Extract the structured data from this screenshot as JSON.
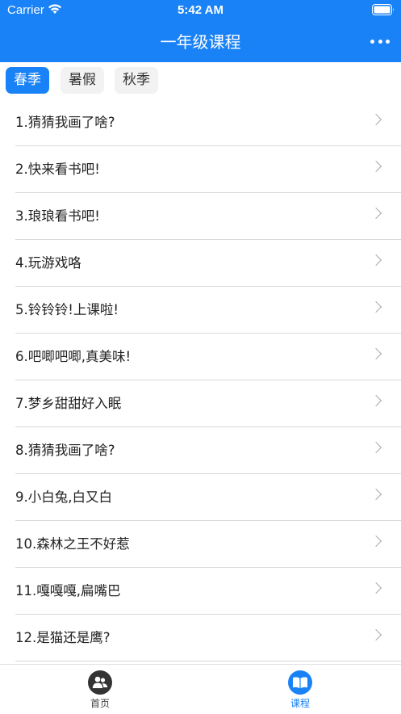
{
  "status": {
    "carrier": "Carrier",
    "time": "5:42 AM"
  },
  "nav": {
    "title": "一年级课程",
    "more_icon": "more-dots-icon"
  },
  "tabs": [
    {
      "label": "春季",
      "active": true
    },
    {
      "label": "暑假",
      "active": false
    },
    {
      "label": "秋季",
      "active": false
    }
  ],
  "lessons": [
    "1.猜猜我画了啥?",
    "2.快来看书吧!",
    "3.琅琅看书吧!",
    "4.玩游戏咯",
    "5.铃铃铃!上课啦!",
    "6.吧唧吧唧,真美味!",
    "7.梦乡甜甜好入眠",
    "8.猜猜我画了啥?",
    "9.小白兔,白又白",
    "10.森林之王不好惹",
    "11.嘎嘎嘎,扁嘴巴",
    "12.是猫还是鹰?"
  ],
  "tabbar": {
    "home": {
      "label": "首页",
      "icon": "users-icon"
    },
    "course": {
      "label": "课程",
      "icon": "book-icon",
      "active": true
    }
  },
  "colors": {
    "accent": "#1a82f7"
  }
}
